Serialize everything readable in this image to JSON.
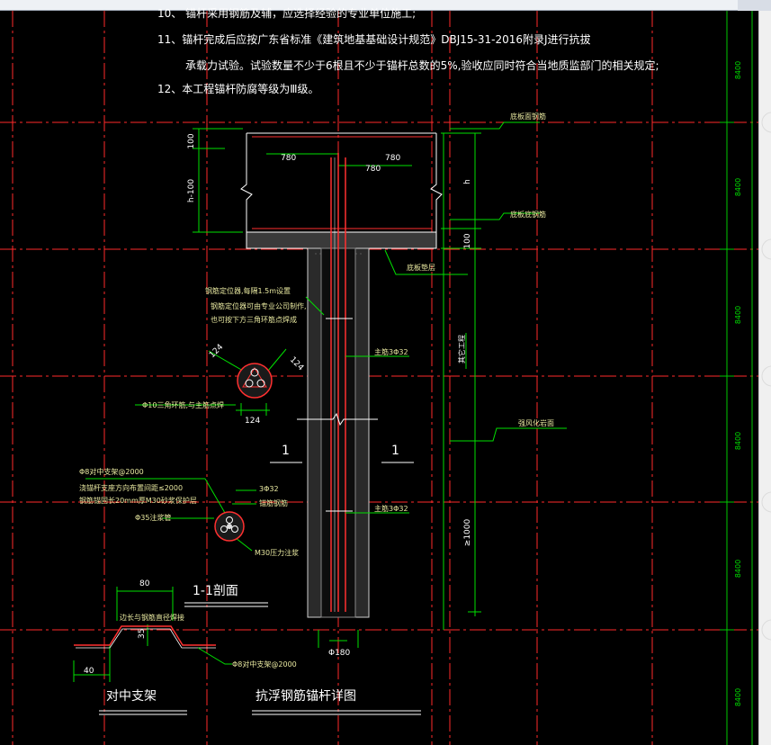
{
  "notes": {
    "line10": "10、 锚杆采用钢筋及辅，应选择经验的专业单位施工;",
    "line11a": "11、锚杆完成后应按广东省标准《建筑地基基础设计规范》DBJ15-31-2016附录J进行抗拔",
    "line11b": "承载力试验。试验数量不少于6根且不少于锚杆总数的5%,验收应同时符合当地质监部门的相关规定;",
    "line12": "12、本工程锚杆防腐等级为Ⅲ级。"
  },
  "dims": {
    "d100_top": "100",
    "d_h100": "h-100",
    "d780_left": "780",
    "d780_right": "780",
    "d_h": "h",
    "d100_right": "100",
    "d124_a": "124",
    "d124_b": "124",
    "d124_c": "124",
    "d1000": "≥1000",
    "d180": "Φ180",
    "d80": "80",
    "d35": "35",
    "d40": "40"
  },
  "labels": {
    "top_rebar": "底板面钢筋",
    "bottom_rebar": "底板底钢筋",
    "cushion": "底板垫层",
    "bar_length": "其它工程",
    "rock_face": "强风化岩面",
    "dowel_note1": "钢筋定位器,每隔1.5m设置",
    "dowel_note2": "钢筋定位器可由专业公司制作,",
    "dowel_note3": "也可按下方三角环筋点焊成",
    "triangle_ring": "Φ10三角环筋,与主筋点焊",
    "main_bar_1": "主筋3Φ32",
    "main_bar_2": "主筋3Φ32",
    "section_1a": "1",
    "section_1b": "1",
    "support_1": "Φ8对中支架@2000",
    "support_2": "浇锚杆支座方向布置间距≤2000",
    "support_3": "钢筋锚固长20mm厚M30砂浆保护层",
    "grout_pipe": "Φ35注浆管",
    "bars_3": "3Φ32",
    "anchor_bar": "锚筋钢筋",
    "m30": "M30压力注浆",
    "section_title": "1-1剖面",
    "bracket_note": "边长与钢筋直径焊接",
    "bracket_label": "Φ8对中支架@2000",
    "title_left": "对中支架",
    "title_right": "抗浮钢筋锚杆详图"
  },
  "grid": {
    "axis_dim": "8400"
  },
  "colors": {
    "background": "#000000",
    "notes_text": "#ffffff",
    "axis_red": "#ff2a2a",
    "dim_green": "#00e000",
    "grid_green": "#00c800",
    "label_yellow": "#e8e8a0",
    "anchor_line": "#ff3030"
  }
}
